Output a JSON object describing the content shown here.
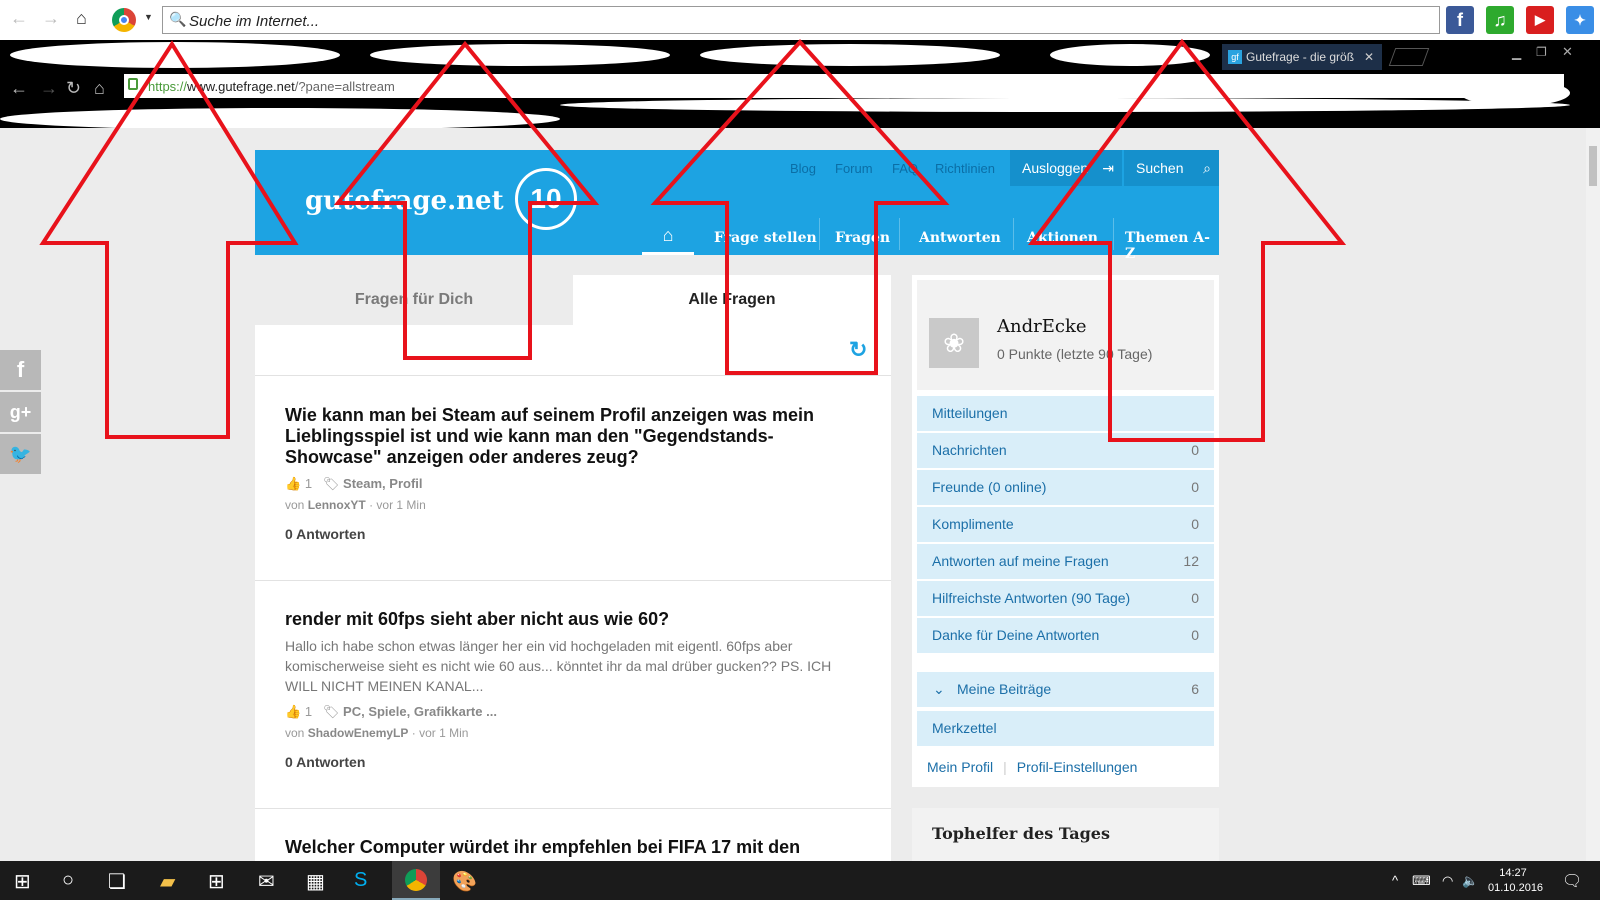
{
  "browser": {
    "search_placeholder": "Suche im Internet...",
    "tab_title": "Gutefrage - die größ",
    "tab_favicon": "gf",
    "url_scheme": "https://",
    "url_domain": "www.gutefrage.net",
    "url_path": "/?pane=allstream"
  },
  "quick_links": {
    "facebook": "f",
    "music": "♫",
    "youtube": "▶"
  },
  "site": {
    "logo": "gutefrage.net",
    "logo_badge": "10",
    "top_links": [
      "Blog",
      "Forum",
      "FAQ",
      "Richtlinien"
    ],
    "logout_label": "Ausloggen",
    "search_label": "Suchen",
    "nav": [
      "Frage stellen",
      "Fragen",
      "Antworten",
      "Aktionen",
      "Themen A-Z"
    ],
    "brand_color": "#1da3e2"
  },
  "tabs": {
    "for_you": "Fragen für Dich",
    "all": "Alle Fragen"
  },
  "questions": [
    {
      "title": "Wie kann man bei Steam auf seinem Profil anzeigen was mein Lieblingsspiel ist und wie kann man den \"Gegendstands-Showcase\" anzeigen oder anderes zeug?",
      "excerpt": "",
      "likes": "1",
      "tags": "Steam, Profil",
      "by_prefix": "von",
      "author": "LennoxYT",
      "time": "· vor 1 Min",
      "answers": "0 Antworten"
    },
    {
      "title": "render mit 60fps sieht aber nicht aus wie 60?",
      "excerpt": "Hallo ich habe schon etwas länger her ein vid hochgeladen mit eigentl. 60fps aber komischerweise sieht es nicht wie 60 aus... könntet ihr da mal drüber gucken?? PS. ICH WILL NICHT MEINEN KANAL...",
      "likes": "1",
      "tags": "PC, Spiele, Grafikkarte ...",
      "by_prefix": "von",
      "author": "ShadowEnemyLP",
      "time": "· vor 1 Min",
      "answers": "0 Antworten"
    },
    {
      "title": "Welcher Computer würdet ihr empfehlen bei FIFA 17 mit den"
    }
  ],
  "user": {
    "name": "AndrEcke",
    "points": "0 Punkte (letzte 90 Tage)"
  },
  "side_menu": [
    {
      "label": "Mitteilungen",
      "count": ""
    },
    {
      "label": "Nachrichten",
      "count": "0"
    },
    {
      "label": "Freunde (0 online)",
      "count": "0"
    },
    {
      "label": "Komplimente",
      "count": "0"
    },
    {
      "label": "Antworten auf meine Fragen",
      "count": "12"
    },
    {
      "label": "Hilfreichste Antworten (90 Tage)",
      "count": "0"
    },
    {
      "label": "Danke für Deine Antworten",
      "count": "0"
    }
  ],
  "meine_beitraege": {
    "label": "Meine Beiträge",
    "count": "6"
  },
  "merkzettel": "Merkzettel",
  "profile_links": {
    "profile": "Mein Profil",
    "settings": "Profil-Einstellungen"
  },
  "tophelfer": "Tophelfer des Tages",
  "taskbar": {
    "time": "14:27",
    "date": "01.10.2016"
  }
}
